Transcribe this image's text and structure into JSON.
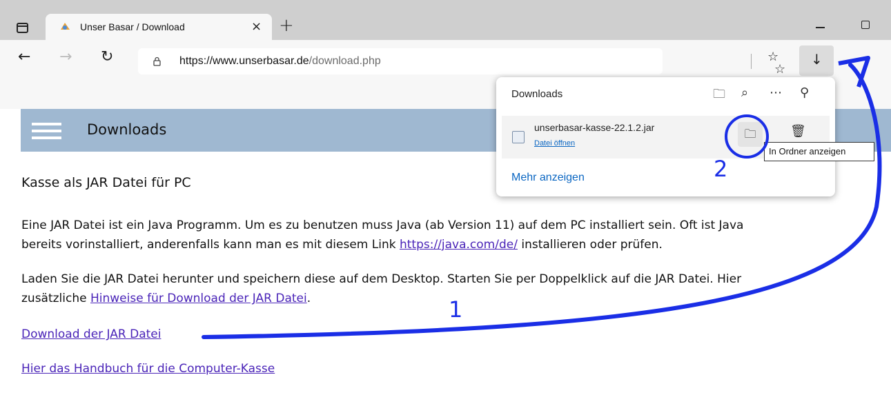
{
  "browser": {
    "tab": {
      "title": "Unser Basar / Download",
      "close": "×"
    },
    "new_tab": "+",
    "address": {
      "url_host": "https://www.unserbasar.de",
      "url_path": "/download.php"
    },
    "icons": {
      "back": "←",
      "forward": "→",
      "reload": "↻",
      "add_favorite": "☆",
      "favorites": "☆",
      "downloads": "↓"
    }
  },
  "page": {
    "header_title": "Downloads",
    "section_title": "Kasse als JAR Datei für PC",
    "p1_line1": "Eine JAR Datei ist ein Java Programm. Um es zu benutzen muss Java (ab Version 11) auf dem PC installiert sein. Oft ist Java",
    "p1_line2_before": "bereits vorinstalliert, anderenfalls kann man es mit diesem Link ",
    "p1_link": "https://java.com/de/",
    "p1_line2_after": " installieren oder prüfen.",
    "p2_line1": "Laden Sie die JAR Datei herunter und speichern diese auf dem Desktop. Starten Sie per Doppelklick auf die JAR Datei. Hier",
    "p2_line2_before": "zusätzliche ",
    "p2_link": "Hinweise für Download der JAR Datei",
    "p2_line2_after": ".",
    "download_link": "Download der JAR Datei",
    "manual_link": "Hier das Handbuch für die Computer-Kasse"
  },
  "downloads_panel": {
    "title": "Downloads",
    "item": {
      "file_name": "unserbasar-kasse-22.1.2.jar",
      "open_label": "Datei öffnen"
    },
    "more_label": "Mehr anzeigen",
    "tooltip": "In Ordner anzeigen"
  },
  "annotations": {
    "step1": "1",
    "step2": "2",
    "color": "#1a2ee6"
  },
  "colors": {
    "header_bar": "#9fb8d1",
    "link": "#4a24b8",
    "panel_link": "#0a66c2"
  }
}
